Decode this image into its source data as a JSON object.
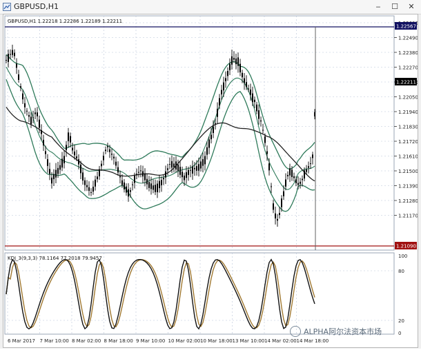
{
  "window": {
    "title": "GBPUSD,H1",
    "minimize": "‒",
    "maximize": "☐",
    "close": "✕"
  },
  "main_chart": {
    "info_label": "GBPUSD,H1  1.22218 1.22286 1.22189 1.22211",
    "price_labels": [
      "1.22600",
      "1.22490",
      "1.22380",
      "1.22270",
      "1.22160",
      "1.22050",
      "1.21940",
      "1.21830",
      "1.21720",
      "1.21610",
      "1.21500",
      "1.21390",
      "1.21280",
      "1.21170"
    ],
    "hline_upper_price": "1.22567",
    "current_price": "1.22211",
    "hline_lower_price": "1.21090",
    "hline_upper_color": "#101060",
    "hline_lower_color": "#a01010"
  },
  "oscillator": {
    "info_label": "KDJ_3(9,3,3) 78.1164 77.2018 79.9457",
    "level_labels": [
      "100",
      "80",
      "20",
      "0"
    ]
  },
  "time_labels": [
    "6 Mar 2017",
    "7 Mar 10:00",
    "8 Mar 02:00",
    "8 Mar 18:00",
    "9 Mar 10:00",
    "10 Mar 02:00",
    "10 Mar 18:00",
    "13 Mar 10:00",
    "14 Mar 02:00",
    "14 Mar 18:00"
  ],
  "watermark": "ALPHA阿尔法资本市场",
  "colors": {
    "bollinger": "#2e7a5a",
    "ma": "#222222",
    "candle": "#000000",
    "k_line": "#111111",
    "d_line": "#a07830",
    "grid": "#b8c4d8"
  },
  "icons": {
    "app": "chart-app-icon",
    "watermark": "wechat-logo-icon"
  }
}
